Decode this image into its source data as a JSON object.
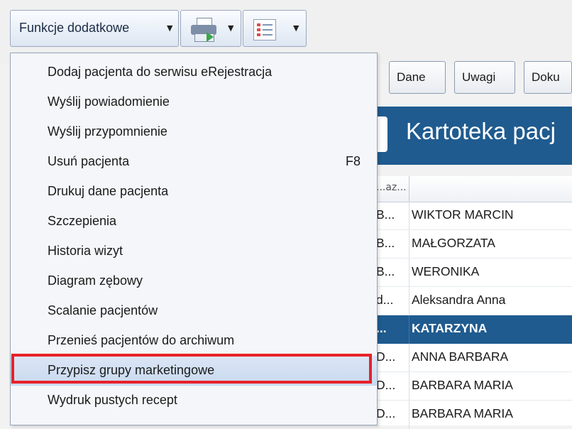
{
  "toolbar": {
    "functions_label": "Funkcje dodatkowe",
    "icons": [
      "printer-icon",
      "view-layout-icon"
    ]
  },
  "tabs": [
    "Dane",
    "Uwagi",
    "Doku"
  ],
  "header": {
    "title": "Kartoteka pacj"
  },
  "grid": {
    "header_col1": "...az...",
    "rows": [
      {
        "c1": "B...",
        "c2": "WIKTOR MARCIN"
      },
      {
        "c1": "B...",
        "c2": "MAŁGORZATA"
      },
      {
        "c1": "B...",
        "c2": "WERONIKA"
      },
      {
        "c1": "d...",
        "c2": "Aleksandra Anna"
      },
      {
        "c1": "...",
        "c2": "KATARZYNA",
        "selected": true
      },
      {
        "c1": "D...",
        "c2": "ANNA BARBARA"
      },
      {
        "c1": "D...",
        "c2": "BARBARA MARIA"
      },
      {
        "c1": "D...",
        "c2": "BARBARA MARIA"
      }
    ]
  },
  "menu": {
    "items": [
      {
        "label": "Dodaj pacjenta do serwisu eRejestracja"
      },
      {
        "label": "Wyślij powiadomienie"
      },
      {
        "label": "Wyślij przypomnienie"
      },
      {
        "label": "Usuń pacjenta",
        "shortcut": "F8"
      },
      {
        "label": "Drukuj dane pacjenta"
      },
      {
        "label": "Szczepienia"
      },
      {
        "label": "Historia wizyt"
      },
      {
        "label": "Diagram zębowy"
      },
      {
        "label": "Scalanie pacjentów"
      },
      {
        "label": "Przenieś pacjentów do archiwum"
      },
      {
        "label": "Przypisz grupy marketingowe",
        "highlighted": true
      },
      {
        "label": "Wydruk pustych recept"
      }
    ]
  },
  "colors": {
    "accent_blue": "#1f5b8f",
    "highlight_border": "#e8212a",
    "menu_hover": "#c9d9ef"
  }
}
